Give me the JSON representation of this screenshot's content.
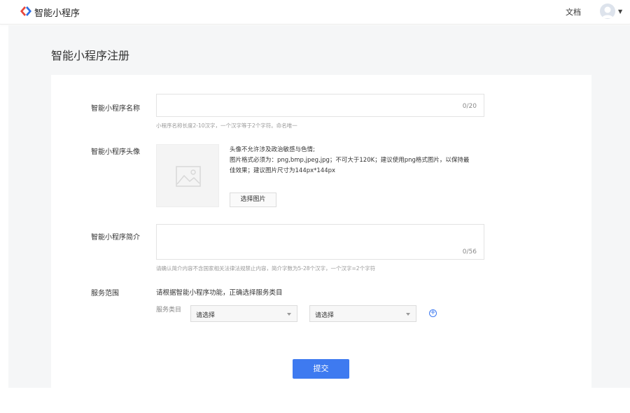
{
  "header": {
    "app_name": "智能小程序",
    "doc_link": "文档",
    "icons": [
      "brand-logo",
      "avatar-icon",
      "caret-down-icon"
    ]
  },
  "page": {
    "title": "智能小程序注册"
  },
  "form": {
    "name": {
      "label": "智能小程序名称",
      "value": "",
      "counter": "0/20",
      "hint": "小程序名称长度2-10汉字，一个汉字等于2个字符。命名唯一"
    },
    "avatar": {
      "label": "智能小程序头像",
      "rule_lines": [
        "头像不允许涉及政治敏感与色情;",
        "图片格式必须为：png,bmp,jpeg,jpg；不可大于120K；建议使用png格式图片，以保持最",
        "佳效果；建议图片尺寸为144px*144px"
      ],
      "button": "选择图片",
      "placeholder_icon": "image-placeholder-icon"
    },
    "intro": {
      "label": "智能小程序简介",
      "value": "",
      "counter": "0/56",
      "hint": "请确认简介内容不含国家相关法律法规禁止内容，简介字数为5-28个汉字，一个汉字=2个字符"
    },
    "service": {
      "label": "服务范围",
      "description": "请根据智能小程序功能，正确选择服务类目",
      "category_label": "服务类目",
      "select1": "请选择",
      "select2": "请选择",
      "add_icon": "add-circle-icon"
    },
    "submit": "提交"
  },
  "colors": {
    "accent": "#3e7af0",
    "background": "#f5f6f7"
  }
}
